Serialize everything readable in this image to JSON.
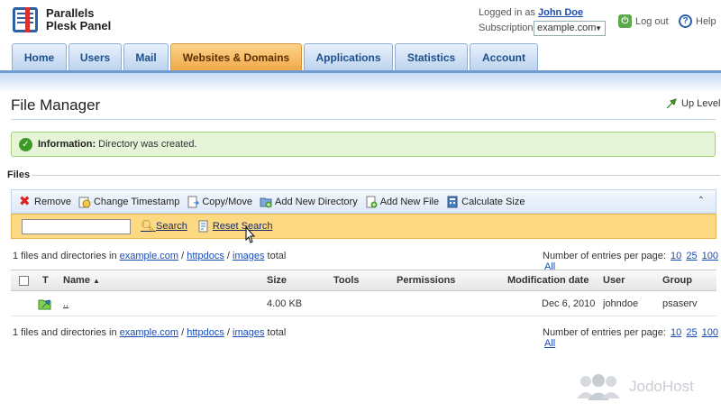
{
  "app": {
    "brand_line1": "Parallels",
    "brand_line2": "Plesk Panel"
  },
  "header": {
    "logged_in_as": "Logged in as",
    "user_name": "John Doe",
    "subscription_label": "Subscription",
    "subscription_value": "example.com",
    "logout_label": "Log out",
    "help_label": "Help"
  },
  "tabs": [
    {
      "label": "Home"
    },
    {
      "label": "Users"
    },
    {
      "label": "Mail"
    },
    {
      "label": "Websites & Domains",
      "active": true
    },
    {
      "label": "Applications"
    },
    {
      "label": "Statistics"
    },
    {
      "label": "Account"
    }
  ],
  "page": {
    "title": "File Manager",
    "up_level": "Up Level"
  },
  "info": {
    "label": "Information:",
    "message": "Directory was created."
  },
  "files": {
    "section_label": "Files",
    "toolbar": {
      "remove": "Remove",
      "change_timestamp": "Change Timestamp",
      "copy_move": "Copy/Move",
      "add_directory": "Add New Directory",
      "add_file": "Add New File",
      "calculate_size": "Calculate Size"
    },
    "search": {
      "value": "",
      "search_label": "Search",
      "reset_label": "Reset Search"
    },
    "path": {
      "prefix": "1 files and directories in",
      "segments": [
        "example.com",
        "httpdocs",
        "images"
      ],
      "sep": "/",
      "suffix": "total"
    },
    "per_page": {
      "label": "Number of entries per page:",
      "options": [
        "10",
        "25",
        "100",
        "All"
      ]
    },
    "columns": {
      "type": "T",
      "name": "Name",
      "sort_indicator": "▲",
      "size": "Size",
      "tools": "Tools",
      "permissions": "Permissions",
      "modified": "Modification date",
      "user": "User",
      "group": "Group"
    },
    "rows": [
      {
        "name": "..",
        "size": "4.00 KB",
        "tools": "",
        "permissions": "",
        "modified": "Dec 6, 2010",
        "user": "johndoe",
        "group": "psaserv"
      }
    ]
  },
  "watermark": {
    "text": "JodoHost"
  },
  "colors": {
    "accent_tab": "#f2a94a",
    "tab_blue": "#bcd3ee",
    "info_bg": "#e6f5d8",
    "search_bar": "#fdd983",
    "link": "#1a4db3"
  }
}
